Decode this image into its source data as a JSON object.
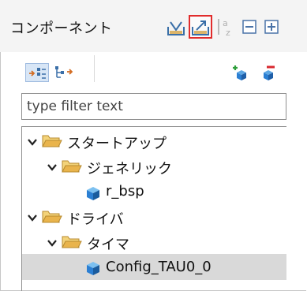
{
  "panel": {
    "title": "コンポーネント",
    "toolbar": [
      {
        "name": "import-button",
        "icon": "import-tray-icon"
      },
      {
        "name": "export-button",
        "icon": "export-tray-icon",
        "active": true
      },
      {
        "name": "sort-button",
        "icon": "sort-az-icon"
      },
      {
        "name": "collapse-all-button",
        "icon": "collapse-all-icon"
      },
      {
        "name": "expand-all-button",
        "icon": "expand-all-icon"
      }
    ],
    "subtoolbar": [
      {
        "name": "view-type-button",
        "icon": "component-view-icon",
        "selected": true
      },
      {
        "name": "view-hierarchy-button",
        "icon": "hierarchy-view-icon"
      },
      {
        "name": "add-component-button",
        "icon": "add-component-icon"
      },
      {
        "name": "remove-component-button",
        "icon": "remove-component-icon"
      }
    ],
    "filter": {
      "placeholder": "type filter text",
      "value": ""
    }
  },
  "tree": [
    {
      "label": "スタートアップ",
      "type": "folder",
      "expanded": true
    },
    {
      "label": "ジェネリック",
      "type": "folder",
      "expanded": true
    },
    {
      "label": "r_bsp",
      "type": "component"
    },
    {
      "label": "ドライバ",
      "type": "folder",
      "expanded": true
    },
    {
      "label": "タイマ",
      "type": "folder",
      "expanded": true
    },
    {
      "label": "Config_TAU0_0",
      "type": "component",
      "selected": true
    }
  ],
  "colors": {
    "folder": "#e9b44c",
    "component": "#2b7fd3",
    "highlight": "#e12c2c",
    "selection": "#d9d9d9"
  }
}
